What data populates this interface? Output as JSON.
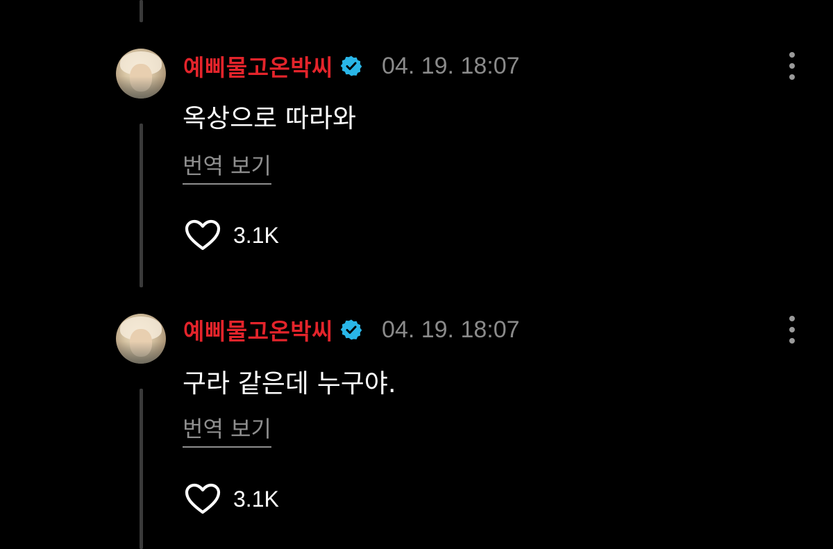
{
  "comments": [
    {
      "username": "예삐물고온박씨",
      "timestamp": "04. 19. 18:07",
      "text": "옥상으로 따라와",
      "translate_label": "번역 보기",
      "like_count": "3.1K"
    },
    {
      "username": "예삐물고온박씨",
      "timestamp": "04. 19. 18:07",
      "text": "구라 같은데 누구야.",
      "translate_label": "번역 보기",
      "like_count": "3.1K"
    }
  ],
  "icons": {
    "verified": "verified-badge-icon",
    "more": "more-vertical-icon",
    "like": "heart-outline-icon"
  },
  "colors": {
    "background": "#000000",
    "username": "#e3242b",
    "verified": "#29b6e8",
    "timestamp": "#8a8a8a",
    "muted": "#8f8f8f",
    "thread_line": "#3a3a3a"
  }
}
